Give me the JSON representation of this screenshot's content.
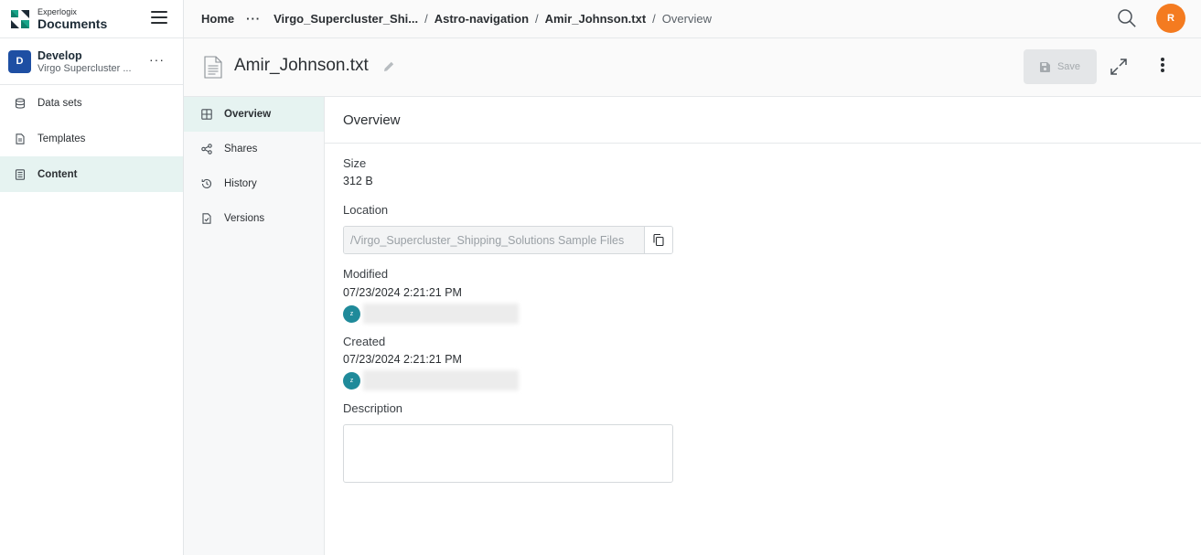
{
  "app": {
    "brand_top": "Experlogix",
    "brand_bottom": "Documents"
  },
  "workspace": {
    "badge": "D",
    "name": "Develop",
    "subtitle": "Virgo Supercluster ...",
    "more": "···"
  },
  "sidebar": {
    "items": [
      {
        "label": "Data sets",
        "icon": "database-icon"
      },
      {
        "label": "Templates",
        "icon": "template-icon"
      },
      {
        "label": "Content",
        "icon": "content-icon",
        "active": true
      }
    ]
  },
  "breadcrumb": {
    "home": "Home",
    "ellipsis": "···",
    "items": [
      "Virgo_Supercluster_Shi...",
      "Astro-navigation",
      "Amir_Johnson.txt"
    ],
    "current": "Overview",
    "separator": "/"
  },
  "user": {
    "initial": "R",
    "color": "#f47b20"
  },
  "file": {
    "title": "Amir_Johnson.txt"
  },
  "toolbar": {
    "save_label": "Save"
  },
  "subnav": {
    "items": [
      {
        "label": "Overview",
        "icon": "grid-icon",
        "active": true
      },
      {
        "label": "Shares",
        "icon": "share-icon"
      },
      {
        "label": "History",
        "icon": "history-icon"
      },
      {
        "label": "Versions",
        "icon": "versions-icon"
      }
    ]
  },
  "overview": {
    "heading": "Overview",
    "size_label": "Size",
    "size_value": "312 B",
    "location_label": "Location",
    "location_value": "/Virgo_Supercluster_Shipping_Solutions Sample Files",
    "modified_label": "Modified",
    "modified_value": "07/23/2024 2:21:21 PM",
    "modified_by_initial": "z",
    "created_label": "Created",
    "created_value": "07/23/2024 2:21:21 PM",
    "created_by_initial": "z",
    "description_label": "Description",
    "description_value": ""
  },
  "colors": {
    "accent": "#1e4fa3",
    "active_bg": "#e6f3f1",
    "user_avatar": "#1f8a9a",
    "logo_teal": "#17a589",
    "logo_dark": "#1d2b36"
  }
}
